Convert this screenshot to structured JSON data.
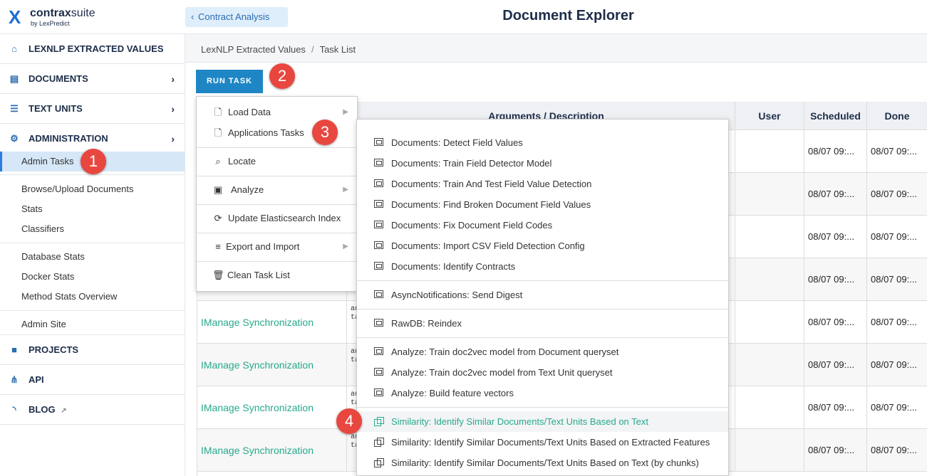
{
  "header": {
    "logo_mark": "X",
    "logo_brand_bold": "contrax",
    "logo_brand_light": "suite",
    "logo_sub": "by LexPredict",
    "back_button": "Contract Analysis",
    "page_title": "Document Explorer"
  },
  "sidebar": {
    "main": [
      {
        "label": "LEXNLP EXTRACTED VALUES",
        "icon": "home-icon",
        "has_arrow": false
      },
      {
        "label": "DOCUMENTS",
        "icon": "document-icon",
        "has_arrow": true
      },
      {
        "label": "TEXT UNITS",
        "icon": "list-icon",
        "has_arrow": true
      },
      {
        "label": "ADMINISTRATION",
        "icon": "gears-icon",
        "has_arrow": true
      }
    ],
    "admin_items": [
      {
        "label": "Admin Tasks",
        "active": true
      },
      {
        "label": "Browse/Upload Documents"
      },
      {
        "label": "Stats"
      },
      {
        "label": "Classifiers"
      },
      {
        "label": "Database Stats"
      },
      {
        "label": "Docker Stats"
      },
      {
        "label": "Method Stats Overview"
      },
      {
        "label": "Admin Site"
      }
    ],
    "bottom": [
      {
        "label": "PROJECTS",
        "icon": "briefcase-icon"
      },
      {
        "label": "API",
        "icon": "sitemap-icon"
      },
      {
        "label": "BLOG",
        "icon": "rss-icon"
      }
    ]
  },
  "breadcrumb": {
    "items": [
      "LexNLP Extracted Values",
      "Task List"
    ],
    "separator": "/"
  },
  "run_task_label": "RUN TASK",
  "dropdown": {
    "items": [
      {
        "label": "Load Data",
        "icon": "file-icon",
        "has_arrow": true
      },
      {
        "label": "Applications Tasks",
        "icon": "file-icon",
        "has_arrow": false
      },
      {
        "label": "Locate",
        "icon": "search-icon",
        "has_arrow": false
      },
      {
        "label": "Analyze",
        "icon": "analyze-icon",
        "has_arrow": true
      },
      {
        "label": "Update Elasticsearch Index",
        "icon": "refresh-icon",
        "has_arrow": false
      },
      {
        "label": "Export and Import",
        "icon": "database-icon",
        "has_arrow": true
      },
      {
        "label": "Clean Task List",
        "icon": "trash-icon",
        "has_arrow": false
      }
    ]
  },
  "submenu": {
    "groups": [
      [
        "Documents: Detect Field Values",
        "Documents: Train Field Detector Model",
        "Documents: Train And Test Field Value Detection",
        "Documents: Find Broken Document Field Values",
        "Documents: Fix Document Field Codes",
        "Documents: Import CSV Field Detection Config",
        "Documents: Identify Contracts"
      ],
      [
        "AsyncNotifications: Send Digest"
      ],
      [
        "RawDB: Reindex"
      ],
      [
        "Analyze: Train doc2vec model from Document queryset",
        "Analyze: Train doc2vec model from Text Unit queryset",
        "Analyze: Build feature vectors"
      ],
      [
        "Similarity: Identify Similar Documents/Text Units Based on Text",
        "Similarity: Identify Similar Documents/Text Units Based on Extracted Features",
        "Similarity: Identify Similar Documents/Text Units Based on Text (by chunks)"
      ]
    ],
    "highlighted": "Similarity: Identify Similar Documents/Text Units Based on Text"
  },
  "table": {
    "headers": [
      "Arguments / Description",
      "User",
      "Scheduled",
      "Done"
    ],
    "rows": [
      {
        "name": "",
        "args": "",
        "scheduled": "08/07 09:...",
        "done": "08/07 09:..."
      },
      {
        "name": "",
        "args": "",
        "scheduled": "08/07 09:...",
        "done": "08/07 09:..."
      },
      {
        "name": "",
        "args": "",
        "scheduled": "08/07 09:...",
        "done": "08/07 09:..."
      },
      {
        "name": "",
        "args": "",
        "scheduled": "08/07 09:...",
        "done": "08/07 09:..."
      },
      {
        "name": "IManage Synchronization",
        "args": "au\nta",
        "scheduled": "08/07 09:...",
        "done": "08/07 09:..."
      },
      {
        "name": "IManage Synchronization",
        "args": "au\nta",
        "scheduled": "08/07 09:...",
        "done": "08/07 09:..."
      },
      {
        "name": "IManage Synchronization",
        "args": "au\nta",
        "scheduled": "08/07 09:...",
        "done": "08/07 09:..."
      },
      {
        "name": "IManage Synchronization",
        "args": "au\nta",
        "scheduled": "08/07 09:...",
        "done": "08/07 09:..."
      }
    ]
  },
  "callouts": [
    "1",
    "2",
    "3",
    "4"
  ],
  "colors": {
    "accent": "#1e86c4",
    "link_green": "#27a98b",
    "callout": "#e8473f",
    "navy": "#1d2d4a"
  }
}
